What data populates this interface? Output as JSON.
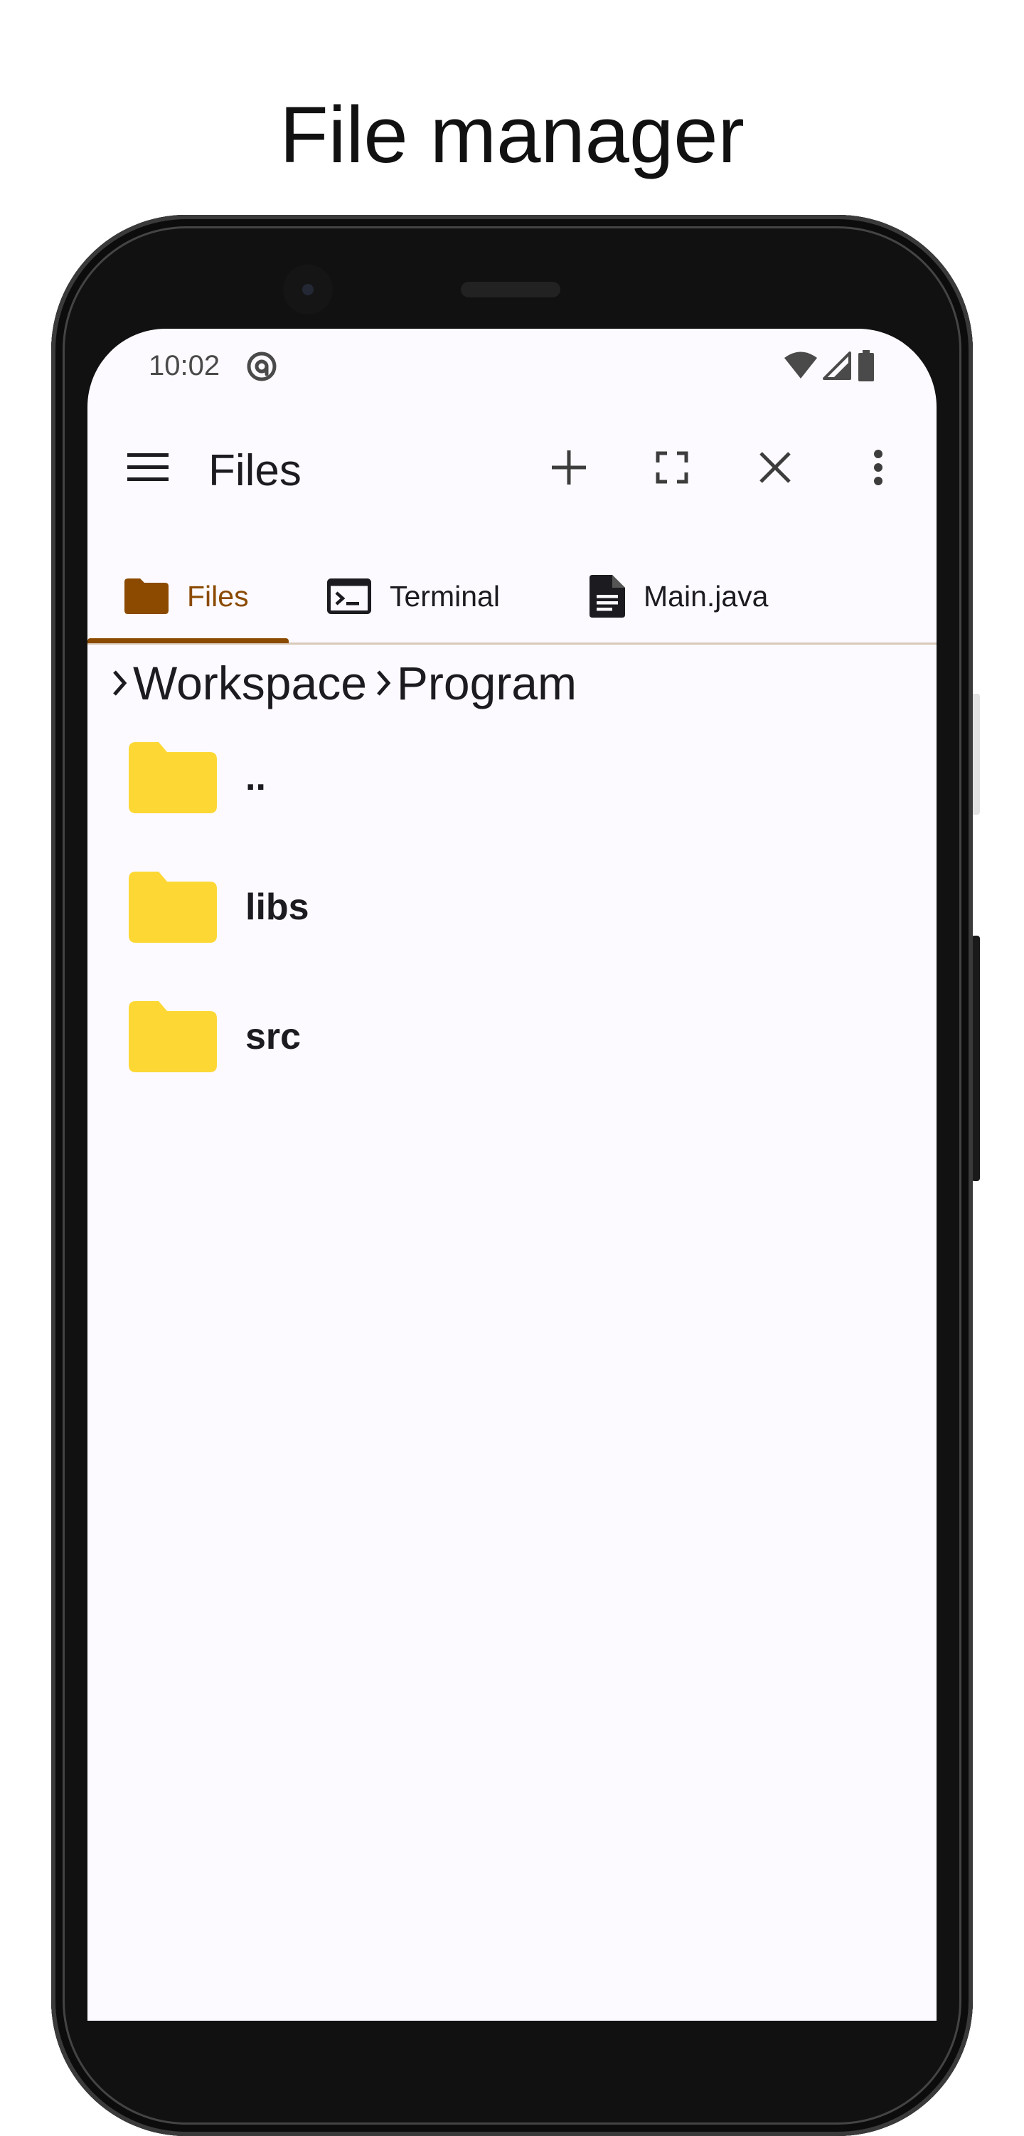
{
  "headline": "File manager",
  "status_bar": {
    "time": "10:02"
  },
  "app_bar": {
    "title": "Files",
    "icons": [
      "menu-icon",
      "add-icon",
      "fullscreen-icon",
      "close-icon",
      "more-vert-icon"
    ]
  },
  "tabs": [
    {
      "label": "Files",
      "icon": "folder-icon",
      "active": true
    },
    {
      "label": "Terminal",
      "icon": "terminal-icon",
      "active": false
    },
    {
      "label": "Main.java",
      "icon": "document-icon",
      "active": false
    }
  ],
  "breadcrumb": [
    "Workspace",
    "Program"
  ],
  "files": [
    {
      "name": "..",
      "type": "folder"
    },
    {
      "name": "libs",
      "type": "folder"
    },
    {
      "name": "src",
      "type": "folder"
    }
  ],
  "colors": {
    "accent": "#8b4a00",
    "folder": "#fdd835",
    "background": "#fcfaff"
  }
}
